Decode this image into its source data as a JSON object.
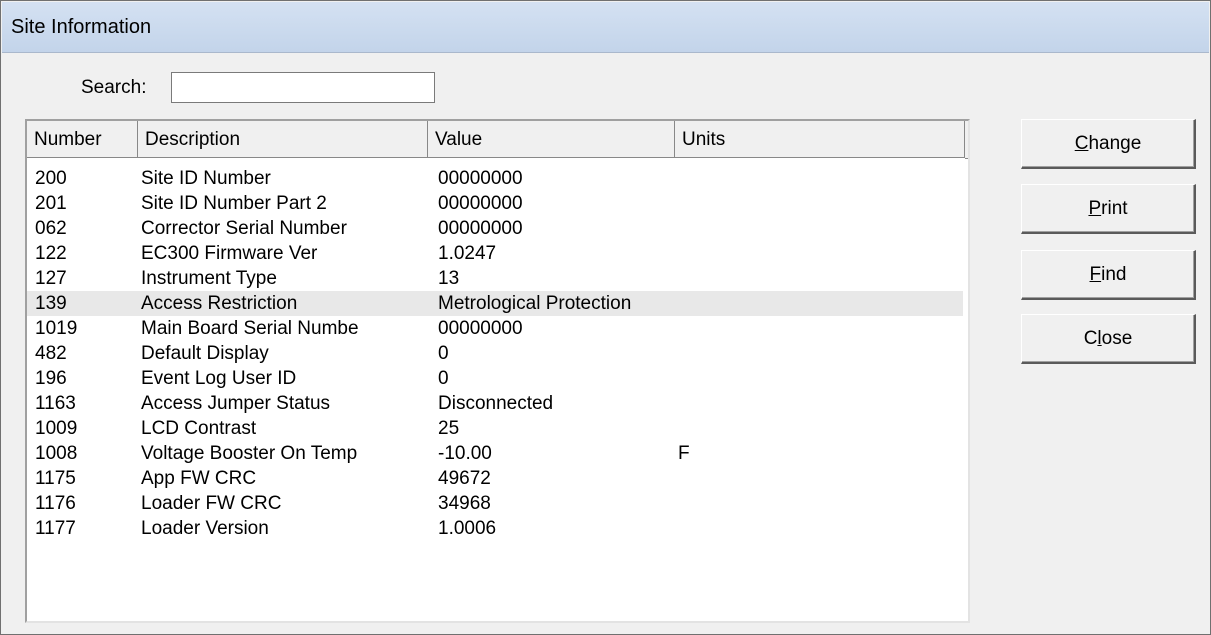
{
  "window": {
    "title": "Site Information"
  },
  "search": {
    "label": "Search:",
    "value": ""
  },
  "list": {
    "columns": [
      "Number",
      "Description",
      "Value",
      "Units"
    ],
    "rows": [
      {
        "number": "200",
        "description": "Site ID Number",
        "value": "00000000",
        "units": ""
      },
      {
        "number": "201",
        "description": "Site ID Number Part 2",
        "value": "00000000",
        "units": ""
      },
      {
        "number": "062",
        "description": "Corrector Serial Number",
        "value": "00000000",
        "units": ""
      },
      {
        "number": "122",
        "description": "EC300 Firmware Ver",
        "value": "1.0247",
        "units": ""
      },
      {
        "number": "127",
        "description": "Instrument Type",
        "value": "13",
        "units": ""
      },
      {
        "number": "139",
        "description": "Access Restriction",
        "value": "Metrological Protection",
        "units": "",
        "selected": true
      },
      {
        "number": "1019",
        "description": "Main Board Serial Numbe",
        "value": "00000000",
        "units": ""
      },
      {
        "number": "482",
        "description": "Default Display",
        "value": "0",
        "units": ""
      },
      {
        "number": "196",
        "description": "Event Log User ID",
        "value": "0",
        "units": ""
      },
      {
        "number": "1163",
        "description": "Access Jumper Status",
        "value": "Disconnected",
        "units": ""
      },
      {
        "number": "1009",
        "description": "LCD Contrast",
        "value": "25",
        "units": ""
      },
      {
        "number": "1008",
        "description": "Voltage Booster On Temp",
        "value": "-10.00",
        "units": "F"
      },
      {
        "number": "1175",
        "description": "App FW CRC",
        "value": "49672",
        "units": ""
      },
      {
        "number": "1176",
        "description": "Loader FW CRC",
        "value": "34968",
        "units": ""
      },
      {
        "number": "1177",
        "description": "Loader Version",
        "value": "1.0006",
        "units": ""
      }
    ]
  },
  "buttons": [
    {
      "name": "change-button",
      "label": "Change",
      "mnemonic": "C"
    },
    {
      "name": "print-button",
      "label": "Print",
      "mnemonic": "P"
    },
    {
      "name": "find-button",
      "label": "Find",
      "mnemonic": "F"
    },
    {
      "name": "close-button",
      "label": "Close",
      "mnemonic": "l"
    }
  ]
}
